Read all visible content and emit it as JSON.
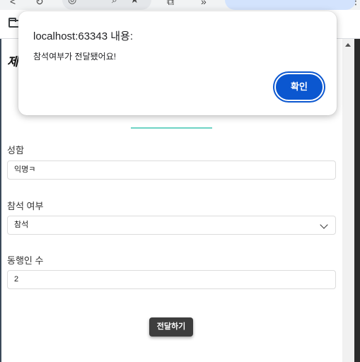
{
  "browser": {
    "bookmark_folder_icon": "folder-icon"
  },
  "page": {
    "heading": "제",
    "fields": [
      {
        "label": "성함",
        "value": "익명ㅋ"
      },
      {
        "label": "참석 여부",
        "value": "참석"
      },
      {
        "label": "동행인 수",
        "value": "2"
      }
    ],
    "submit_label": "전달하기",
    "accent_color": "#6fd3c4"
  },
  "dialog": {
    "title": "localhost:63343 내용:",
    "message": "참석여부가 전달됐어요!",
    "ok_label": "확인",
    "ok_color": "#0b57d0"
  }
}
